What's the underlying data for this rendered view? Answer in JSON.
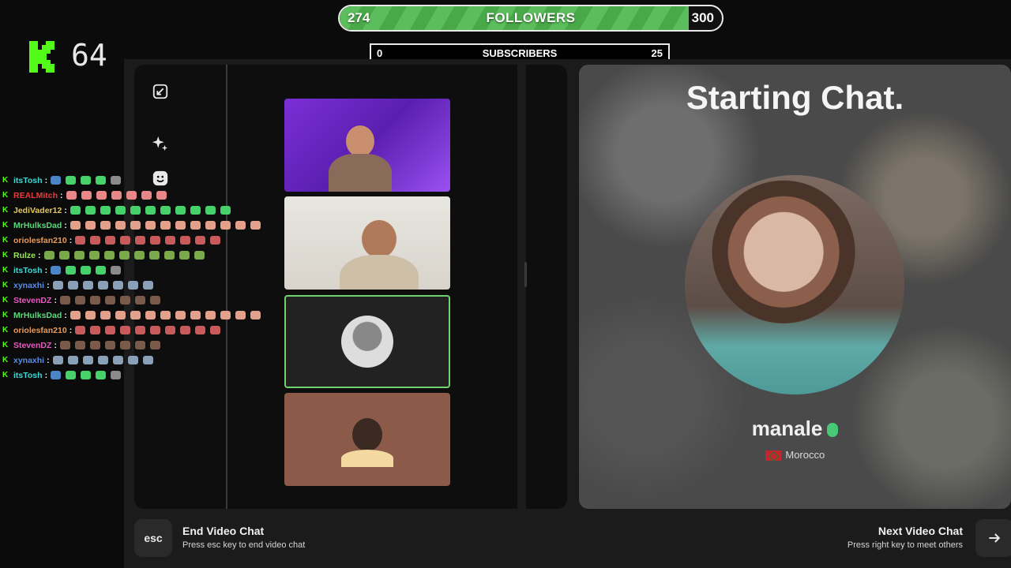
{
  "overlay": {
    "followers": {
      "current": "274",
      "label": "FOLLOWERS",
      "goal": "300",
      "progress": 0.913
    },
    "subscribers": {
      "current": "0",
      "label": "SUBSCRIBERS",
      "goal": "25"
    },
    "viewer_count": "64"
  },
  "chat": [
    {
      "user": "itsTosh",
      "color": "#3dd9d9",
      "emotes": [
        "#4a86c5",
        "#47d16a",
        "#47d16a",
        "#47d16a",
        "#8a8a8a"
      ]
    },
    {
      "user": "REALMitch",
      "color": "#e83b3b",
      "emotes": [
        "#e88787",
        "#e88787",
        "#e88787",
        "#e88787",
        "#e88787",
        "#e88787",
        "#e88787"
      ]
    },
    {
      "user": "JediVader12",
      "color": "#e8c85b",
      "emotes": [
        "#47d16a",
        "#47d16a",
        "#47d16a",
        "#47d16a",
        "#47d16a",
        "#47d16a",
        "#47d16a",
        "#47d16a",
        "#47d16a",
        "#47d16a",
        "#47d16a"
      ]
    },
    {
      "user": "MrHulksDad",
      "color": "#5bd97a",
      "emotes": [
        "#e3a08a",
        "#e3a08a",
        "#e3a08a",
        "#e3a08a",
        "#e3a08a",
        "#e3a08a",
        "#e3a08a",
        "#e3a08a",
        "#e3a08a",
        "#e3a08a",
        "#e3a08a",
        "#e3a08a",
        "#e3a08a"
      ]
    },
    {
      "user": "oriolesfan210",
      "color": "#e89b5b",
      "emotes": [
        "#c75b5b",
        "#c75b5b",
        "#c75b5b",
        "#c75b5b",
        "#c75b5b",
        "#c75b5b",
        "#c75b5b",
        "#c75b5b",
        "#c75b5b",
        "#c75b5b"
      ]
    },
    {
      "user": "Rulze",
      "color": "#9be85b",
      "emotes": [
        "#7aa84a",
        "#7aa84a",
        "#7aa84a",
        "#7aa84a",
        "#7aa84a",
        "#7aa84a",
        "#7aa84a",
        "#7aa84a",
        "#7aa84a",
        "#7aa84a",
        "#7aa84a"
      ]
    },
    {
      "user": "itsTosh",
      "color": "#3dd9d9",
      "emotes": [
        "#4a86c5",
        "#47d16a",
        "#47d16a",
        "#47d16a",
        "#8a8a8a"
      ]
    },
    {
      "user": "xynaxhi",
      "color": "#5b8de8",
      "emotes": [
        "#8aa0b8",
        "#8aa0b8",
        "#8aa0b8",
        "#8aa0b8",
        "#8aa0b8",
        "#8aa0b8",
        "#8aa0b8"
      ]
    },
    {
      "user": "StevenDZ",
      "color": "#e85bc1",
      "emotes": [
        "#7a5a4a",
        "#7a5a4a",
        "#7a5a4a",
        "#7a5a4a",
        "#7a5a4a",
        "#7a5a4a",
        "#7a5a4a"
      ]
    },
    {
      "user": "MrHulksDad",
      "color": "#5bd97a",
      "emotes": [
        "#e3a08a",
        "#e3a08a",
        "#e3a08a",
        "#e3a08a",
        "#e3a08a",
        "#e3a08a",
        "#e3a08a",
        "#e3a08a",
        "#e3a08a",
        "#e3a08a",
        "#e3a08a",
        "#e3a08a",
        "#e3a08a"
      ]
    },
    {
      "user": "oriolesfan210",
      "color": "#e89b5b",
      "emotes": [
        "#c75b5b",
        "#c75b5b",
        "#c75b5b",
        "#c75b5b",
        "#c75b5b",
        "#c75b5b",
        "#c75b5b",
        "#c75b5b",
        "#c75b5b",
        "#c75b5b"
      ]
    },
    {
      "user": "StevenDZ",
      "color": "#e85bc1",
      "emotes": [
        "#7a5a4a",
        "#7a5a4a",
        "#7a5a4a",
        "#7a5a4a",
        "#7a5a4a",
        "#7a5a4a",
        "#7a5a4a"
      ]
    },
    {
      "user": "xynaxhi",
      "color": "#5b8de8",
      "emotes": [
        "#8aa0b8",
        "#8aa0b8",
        "#8aa0b8",
        "#8aa0b8",
        "#8aa0b8",
        "#8aa0b8",
        "#8aa0b8"
      ]
    },
    {
      "user": "itsTosh",
      "color": "#3dd9d9",
      "emotes": [
        "#4a86c5",
        "#47d16a",
        "#47d16a",
        "#47d16a",
        "#8a8a8a"
      ]
    }
  ],
  "toolbar": {
    "icons": [
      "minimize-icon",
      "sparkles-icon",
      "smiley-icon"
    ]
  },
  "stage": {
    "title": "Starting Chat.",
    "username": "manale",
    "country": "Morocco"
  },
  "controls": {
    "esc_key": "esc",
    "end_title": "End Video Chat",
    "end_sub": "Press esc key to end video chat",
    "next_title": "Next Video Chat",
    "next_sub": "Press right key to meet others",
    "next_icon": "arrow-right-icon"
  },
  "colors": {
    "accent": "#53fc18",
    "progress": "#5bbd5b",
    "highlight_border": "#6fd36f"
  }
}
